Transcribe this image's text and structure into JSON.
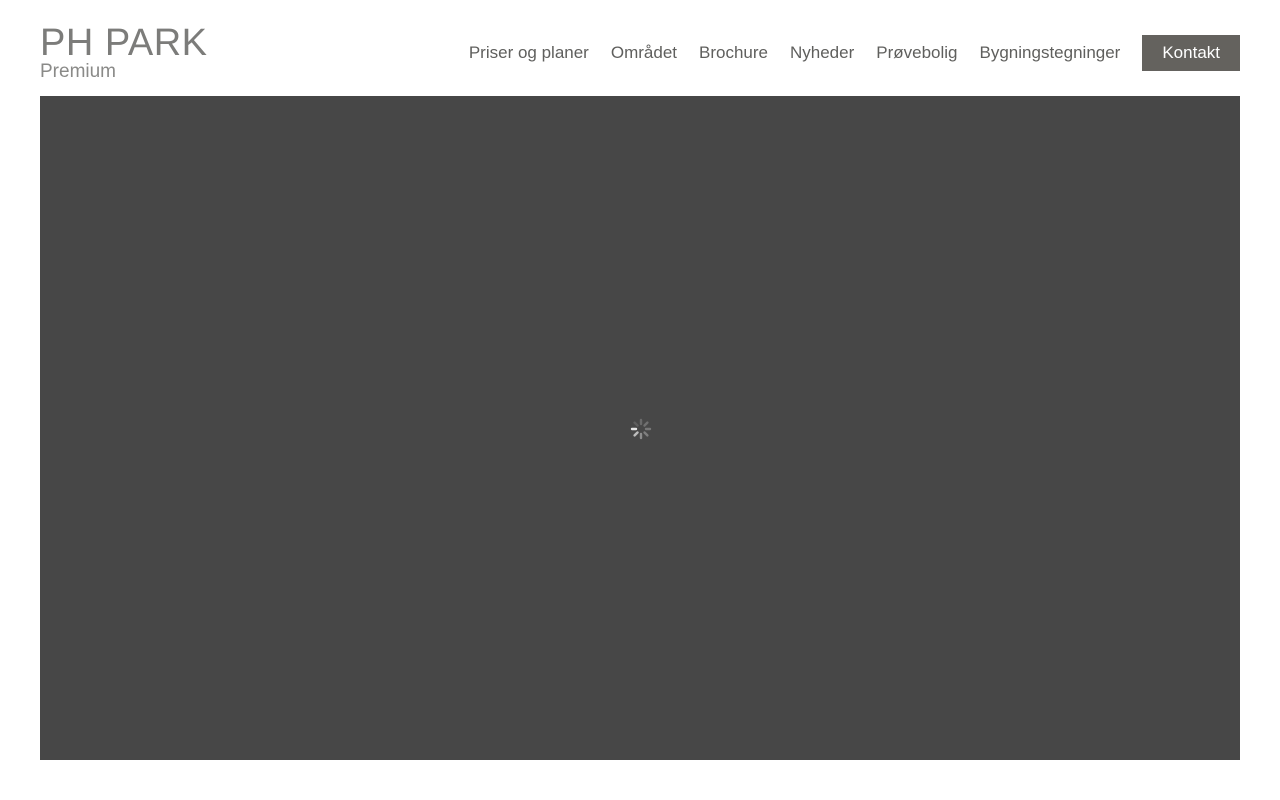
{
  "brand": {
    "name": "PH PARK",
    "tagline": "Premium"
  },
  "nav": {
    "items": [
      {
        "label": "Priser og planer"
      },
      {
        "label": "Området"
      },
      {
        "label": "Brochure"
      },
      {
        "label": "Nyheder"
      },
      {
        "label": "Prøvebolig"
      },
      {
        "label": "Bygningstegninger"
      }
    ],
    "cta_label": "Kontakt"
  },
  "hero": {
    "state": "loading",
    "icon": "loading-spinner-icon",
    "background_color": "#474747"
  },
  "colors": {
    "cta_background": "#64625e",
    "nav_text": "#5f5f5d",
    "logo_text": "#7c7c7a"
  }
}
